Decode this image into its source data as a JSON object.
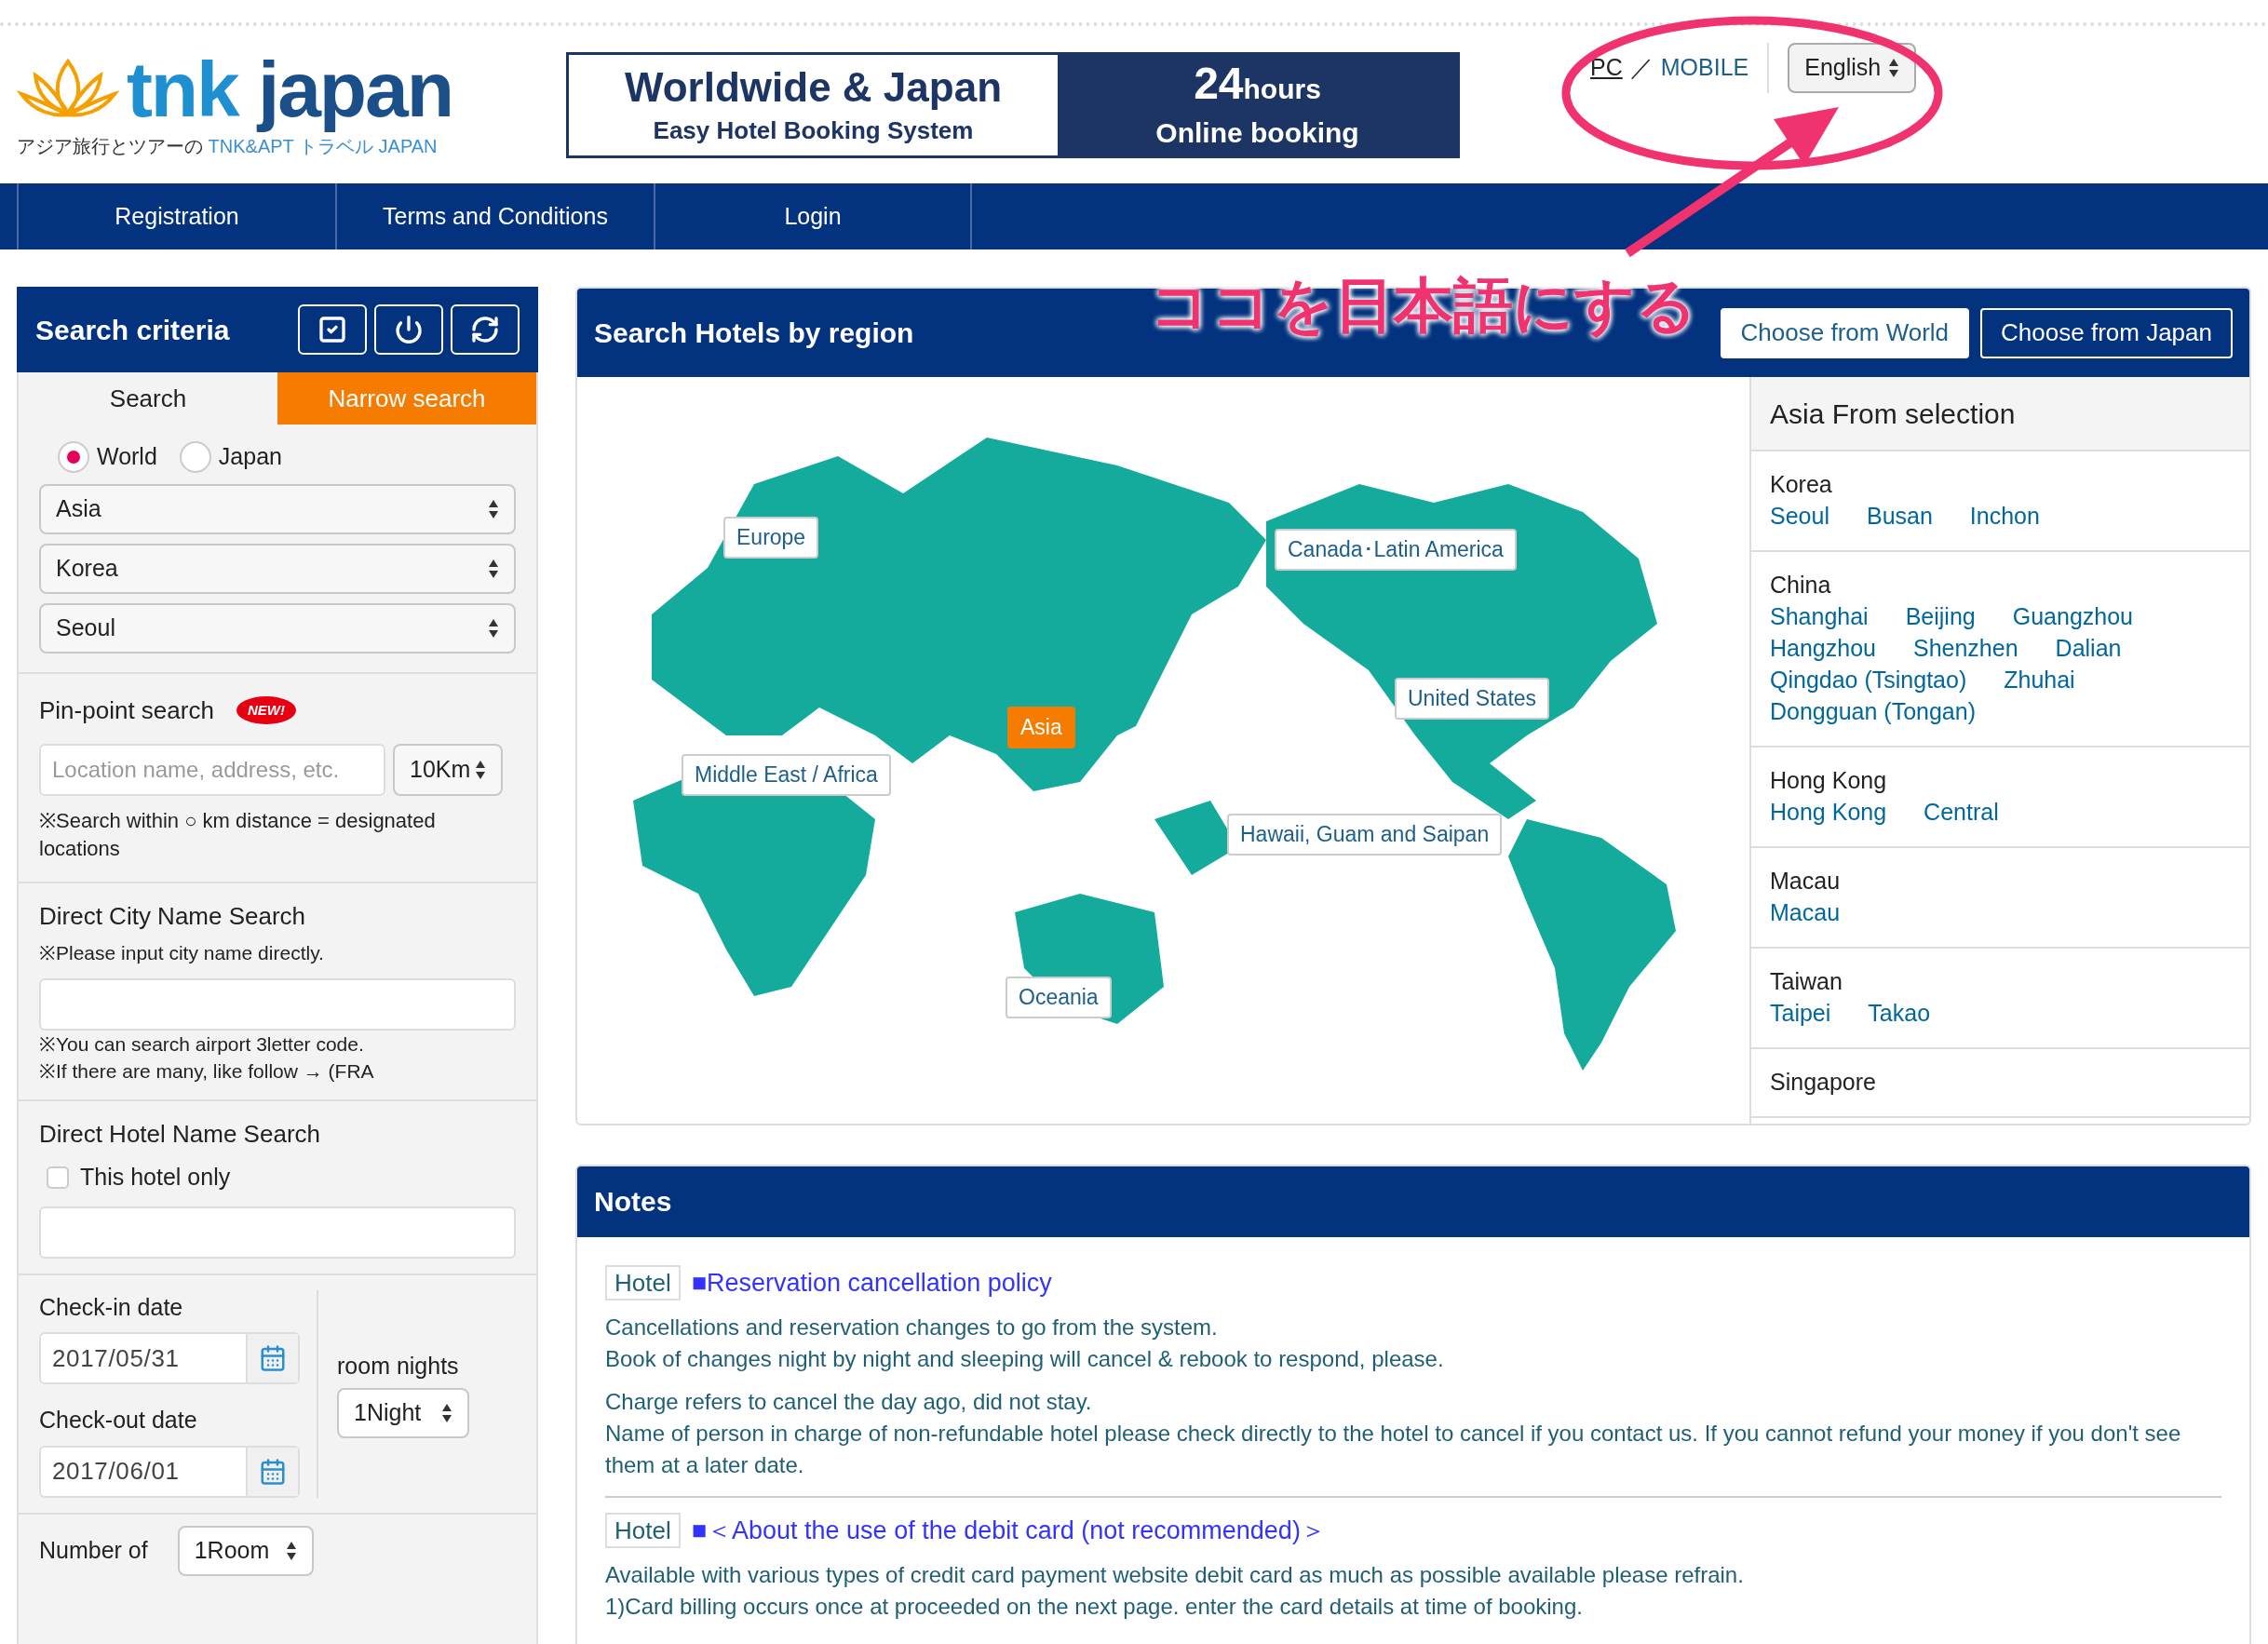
{
  "logo": {
    "brand_first": "tnk",
    "brand_second": "japan",
    "tagline_jp": "アジア旅行とツアーの",
    "tagline_en": "TNK&APT トラベル JAPAN"
  },
  "banner": {
    "title": "Worldwide & Japan",
    "subtitle": "Easy Hotel Booking System",
    "hours_number": "24",
    "hours_unit": "hours",
    "online": "Online booking"
  },
  "header_links": {
    "pc": "PC",
    "separator": "／",
    "mobile": "MOBILE"
  },
  "language_select": {
    "value": "English"
  },
  "nav": [
    {
      "label": "Registration"
    },
    {
      "label": "Terms and Conditions"
    },
    {
      "label": "Login"
    }
  ],
  "search_panel": {
    "title": "Search criteria",
    "tabs": [
      {
        "label": "Search",
        "selected": false
      },
      {
        "label": "Narrow search",
        "selected": true
      }
    ],
    "scope": [
      {
        "label": "World",
        "selected": true
      },
      {
        "label": "Japan",
        "selected": false
      }
    ],
    "selects": [
      "Asia",
      "Korea",
      "Seoul"
    ],
    "pinpoint": {
      "title": "Pin-point search",
      "badge": "NEW!",
      "placeholder": "Location name, address, etc.",
      "distance": "10Km",
      "note": "※Search within ○ km distance = designated locations"
    },
    "city_search": {
      "title": "Direct City Name Search",
      "hint": "※Please input city name directly.",
      "notes": [
        "※You can search airport 3letter code.",
        "※If there are many, like follow → (FRA"
      ]
    },
    "hotel_search": {
      "title": "Direct Hotel Name Search",
      "checkbox": {
        "label": "This hotel only",
        "checked": false
      }
    },
    "checkin": {
      "label": "Check-in date",
      "value": "2017/05/31"
    },
    "checkout": {
      "label": "Check-out date",
      "value": "2017/06/01"
    },
    "nights": {
      "label": "room nights",
      "value": "1Night"
    },
    "rooms": {
      "label": "Number of",
      "value": "1Room"
    }
  },
  "region_panel": {
    "title": "Search Hotels by region",
    "buttons": [
      "Choose from World",
      "Choose from Japan"
    ],
    "regions": [
      {
        "label": "Europe",
        "selected": false
      },
      {
        "label": "Canada･Latin America",
        "selected": false
      },
      {
        "label": "United States",
        "selected": false
      },
      {
        "label": "Asia",
        "selected": true
      },
      {
        "label": "Middle East / Africa",
        "selected": false
      },
      {
        "label": "Hawaii, Guam and Saipan",
        "selected": false
      },
      {
        "label": "Oceania",
        "selected": false
      }
    ],
    "list": {
      "title": "Asia From selection",
      "groups": [
        {
          "country": "Korea",
          "cities": [
            "Seoul",
            "Busan",
            "Inchon"
          ]
        },
        {
          "country": "China",
          "cities": [
            "Shanghai",
            "Beijing",
            "Guangzhou",
            "Hangzhou",
            "Shenzhen",
            "Dalian",
            "Qingdao (Tsingtao)",
            "Zhuhai",
            "Dongguan (Tongan)"
          ]
        },
        {
          "country": "Hong Kong",
          "cities": [
            "Hong Kong",
            "Central"
          ]
        },
        {
          "country": "Macau",
          "cities": [
            "Macau"
          ]
        },
        {
          "country": "Taiwan",
          "cities": [
            "Taipei",
            "Takao"
          ]
        },
        {
          "country": "Singapore"
        }
      ]
    }
  },
  "notes": {
    "title": "Notes",
    "items": [
      {
        "tag": "Hotel",
        "heading": "■Reservation cancellation policy",
        "paragraphs": [
          [
            "Cancellations and reservation changes to go from the system.",
            "Book of changes night by night and sleeping will cancel & rebook to respond, please."
          ],
          [
            "Charge refers to cancel the day ago, did not stay.",
            "Name of person in charge of non-refundable hotel please check directly to the hotel to cancel if you contact us. If you cannot refund your money if you don't see them at a later date."
          ]
        ]
      },
      {
        "tag": "Hotel",
        "heading": "■＜About the use of the debit card (not recommended)＞",
        "paragraphs": [
          [
            "Available with various types of credit card payment website debit card as much as possible available please refrain.",
            "1)Card billing occurs once at proceeded on the next page. enter the card details at time of booking."
          ]
        ]
      }
    ]
  },
  "annotation": {
    "text": "ココを日本語にする"
  }
}
